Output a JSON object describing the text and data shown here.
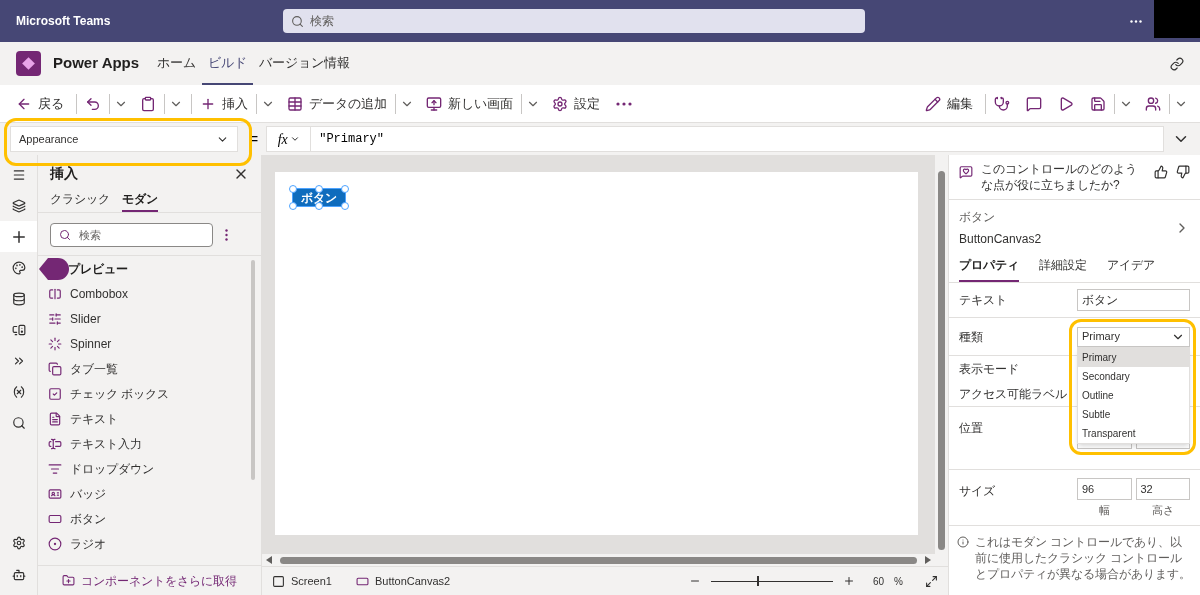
{
  "app_bar": {
    "title": "Microsoft Teams",
    "search": {
      "placeholder": "検索"
    }
  },
  "header": {
    "app_name": "Power Apps",
    "tabs": [
      {
        "label": "ホーム",
        "selected": false
      },
      {
        "label": "ビルド",
        "selected": true
      },
      {
        "label": "バージョン情報",
        "selected": false
      }
    ]
  },
  "toolbar": {
    "left": [
      {
        "kind": "back",
        "label": "戻る"
      },
      {
        "kind": "undo"
      },
      {
        "kind": "paste"
      },
      {
        "kind": "insert",
        "label": "挿入"
      },
      {
        "kind": "data",
        "label": "データの追加"
      },
      {
        "kind": "screen",
        "label": "新しい画面"
      },
      {
        "kind": "settings",
        "label": "設定"
      },
      {
        "kind": "more"
      }
    ],
    "right": [
      {
        "kind": "edit",
        "label": "編集"
      },
      {
        "kind": "checker"
      },
      {
        "kind": "comments"
      },
      {
        "kind": "preview"
      },
      {
        "kind": "save"
      },
      {
        "kind": "teams"
      }
    ]
  },
  "formula_bar": {
    "property": "Appearance",
    "equals": "=",
    "function": "fx",
    "formula": "\"Primary\""
  },
  "rail": [
    {
      "kind": "menu",
      "selected": false
    },
    {
      "kind": "layers",
      "selected": false
    },
    {
      "kind": "insert",
      "selected": true
    },
    {
      "kind": "theme",
      "selected": false
    },
    {
      "kind": "data",
      "selected": false
    },
    {
      "kind": "media",
      "selected": false
    },
    {
      "kind": "flows",
      "selected": false
    },
    {
      "kind": "variables",
      "selected": false
    },
    {
      "kind": "search",
      "selected": false
    }
  ],
  "rail_bottom": [
    {
      "kind": "settings"
    },
    {
      "kind": "agent"
    }
  ],
  "insert_panel": {
    "title": "挿入",
    "tabs": [
      {
        "label": "クラシック",
        "selected": false
      },
      {
        "label": "モダン",
        "selected": true
      }
    ],
    "search": {
      "placeholder": "検索"
    },
    "items": [
      {
        "kind": "heading",
        "label": "プレビュー"
      },
      {
        "kind": "combobox",
        "label": "Combobox"
      },
      {
        "kind": "slider",
        "label": "Slider"
      },
      {
        "kind": "spinner",
        "label": "Spinner"
      },
      {
        "kind": "tabs",
        "label": "タブ一覧"
      },
      {
        "kind": "checkbox",
        "label": "チェック ボックス"
      },
      {
        "kind": "text",
        "label": "テキスト"
      },
      {
        "kind": "textinput",
        "label": "テキスト入力"
      },
      {
        "kind": "dropdown",
        "label": "ドロップダウン"
      },
      {
        "kind": "badge",
        "label": "バッジ"
      },
      {
        "kind": "button",
        "label": "ボタン"
      },
      {
        "kind": "radio",
        "label": "ラジオ"
      }
    ],
    "footer": "コンポーネントをさらに取得"
  },
  "canvas": {
    "button_label": "ボタン"
  },
  "status_bar": {
    "breadcrumbs": [
      {
        "kind": "screen",
        "label": "Screen1"
      },
      {
        "kind": "control",
        "label": "ButtonCanvas2"
      }
    ],
    "zoom": {
      "level": 0.38,
      "reading": "60",
      "unit": "%"
    }
  },
  "properties": {
    "feedback": "このコントロールのどのような点が役に立ちましたか?",
    "control_type": "ボタン",
    "control_name": "ButtonCanvas2",
    "tabs": [
      {
        "label": "プロパティ",
        "selected": true
      },
      {
        "label": "詳細設定",
        "selected": false
      },
      {
        "label": "アイデア",
        "selected": false
      }
    ],
    "rows": [
      {
        "kind": "text",
        "label": "テキスト",
        "value": "ボタン"
      },
      {
        "kind": "dropdown",
        "label": "種類",
        "value": "Primary",
        "options": [
          {
            "label": "Primary",
            "selected": true
          },
          {
            "label": "Secondary",
            "selected": false
          },
          {
            "label": "Outline",
            "selected": false
          },
          {
            "label": "Subtle",
            "selected": false
          },
          {
            "label": "Transparent",
            "selected": false
          }
        ]
      },
      {
        "kind": "plain",
        "label": "表示モード"
      },
      {
        "kind": "plain",
        "label": "アクセス可能ラベル"
      },
      {
        "kind": "pair",
        "label": "位置"
      },
      {
        "kind": "pair",
        "label": "サイズ",
        "fields": [
          {
            "value": "96",
            "caption": "幅"
          },
          {
            "value": "32",
            "caption": "高さ"
          }
        ]
      }
    ],
    "note": "これはモダン コントロールであり、以前に使用したクラシック コントロールとプロパティが異なる場合があります。"
  }
}
